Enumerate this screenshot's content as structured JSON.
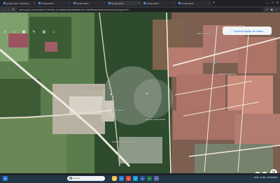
{
  "tabs": [
    {
      "title": "google earth - Pesquisar",
      "active": false,
      "color": "#4aa3ff"
    },
    {
      "title": "Google Earth",
      "active": false,
      "color": "#4aa3ff"
    },
    {
      "title": "Google Earth",
      "active": false,
      "color": "#4aa3ff"
    },
    {
      "title": "Google Earth",
      "active": true,
      "color": "#4aa3ff"
    },
    {
      "title": "Google Earth",
      "active": false,
      "color": "#4aa3ff"
    },
    {
      "title": "Google Earth",
      "active": false,
      "color": "#4aa3ff"
    }
  ],
  "tab_new": "+",
  "window_controls": {
    "minimize": "—",
    "maximize": "□",
    "close": "✕"
  },
  "address_bar": {
    "back": "←",
    "forward": "→",
    "reload": "↻",
    "url": "earth.google.com/web/@-22.7723784,-47.1416664,578.4826491a,4127.36445794d,35y,0h,0t,0r/data=CCgiJgokCTz3..."
  },
  "map_toolbar": {
    "menu": "≡",
    "search": "⌕",
    "layers": "▣",
    "draw": "✎",
    "projects": "▤",
    "measure": "⌂"
  },
  "map": {
    "labels": [
      {
        "text": "Empresa de Aeronáutica\nSANTEC",
        "kind": "poi"
      },
      {
        "text": "Jardim\nTriunfo",
        "kind": "place"
      },
      {
        "text": "Distrito\nIndustrial",
        "kind": "place"
      },
      {
        "text": "Residencial\nBella Vista",
        "kind": "place"
      },
      {
        "text": "Escola Estadual\nProfessora",
        "kind": "place"
      },
      {
        "text": "Mercado Central\nde Vila",
        "kind": "place"
      }
    ]
  },
  "visibility_button": {
    "icon": "◌",
    "label": "Apresentação de slides"
  },
  "status": {
    "left": "Atribuição de dados",
    "right": "Câmera: 4.127 m  22°46'20\"S 47°08'30\"W  578 m"
  },
  "zoom": {
    "in": "+",
    "out": "−"
  },
  "compass": "N",
  "search": {
    "placeholder": "Pesquisar"
  },
  "taskbar_apps": [
    {
      "name": "start",
      "label": "⊞",
      "color": "#2d7bd8"
    },
    {
      "name": "file-explorer",
      "label": "▣",
      "color": "#f2c043"
    },
    {
      "name": "mail",
      "label": "✉",
      "color": "#2d7bd8"
    },
    {
      "name": "chrome",
      "label": "●",
      "color": "#e74c3c"
    },
    {
      "name": "edge",
      "label": "◐",
      "color": "#1ba1e2"
    },
    {
      "name": "word",
      "label": "W",
      "color": "#2b579a"
    },
    {
      "name": "excel",
      "label": "X",
      "color": "#217346"
    },
    {
      "name": "teams",
      "label": "T",
      "color": "#6264a7"
    }
  ],
  "tray": {
    "language": "POR",
    "time": "11:36",
    "date": "17/07/2024"
  }
}
